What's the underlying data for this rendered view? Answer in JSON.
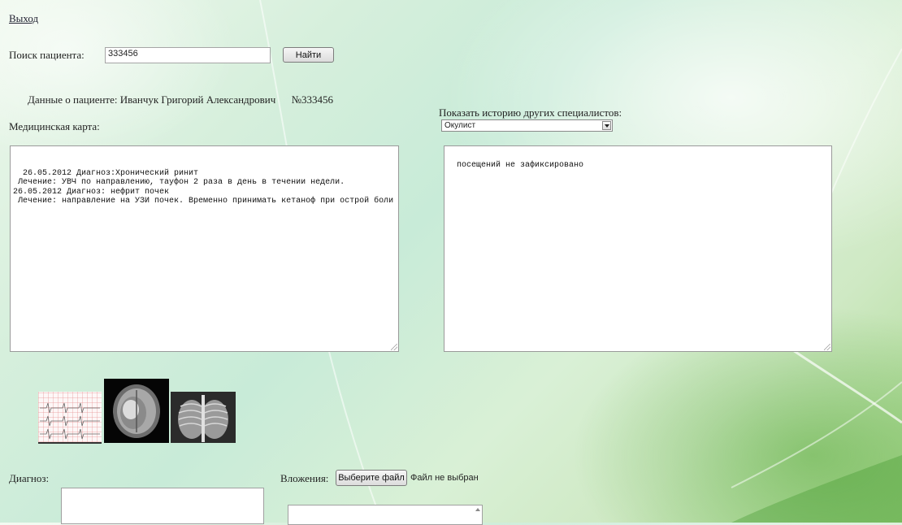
{
  "header": {
    "logout_label": "Выход"
  },
  "search": {
    "label": "Поиск пациента:",
    "value": "333456",
    "button_label": "Найти"
  },
  "patient": {
    "label": "Данные о пациенте:",
    "name": "Иванчук Григорий Александрович",
    "number": "№333456"
  },
  "medical_card": {
    "label": "Медицинская карта:",
    "text": "26.05.2012 Диагноз:Хронический ринит\n Лечение: УВЧ по направлению, тауфон 2 раза в день в течении недели.\n26.05.2012 Диагноз: нефрит почек\n Лечение: направление на УЗИ почек. Временно принимать кетаноф при острой боли"
  },
  "specialists": {
    "label": "Показать историю других специалистов:",
    "selected": "Окулист",
    "history_text": "посещений не зафиксировано"
  },
  "attachments_gallery": {
    "items": [
      "ecg-image",
      "mri-image",
      "xray-image"
    ]
  },
  "diagnosis": {
    "label": "Диагноз:"
  },
  "attachments": {
    "label": "Вложения:",
    "choose_button": "Выберите файл",
    "no_file_text": "Файл не выбран"
  }
}
